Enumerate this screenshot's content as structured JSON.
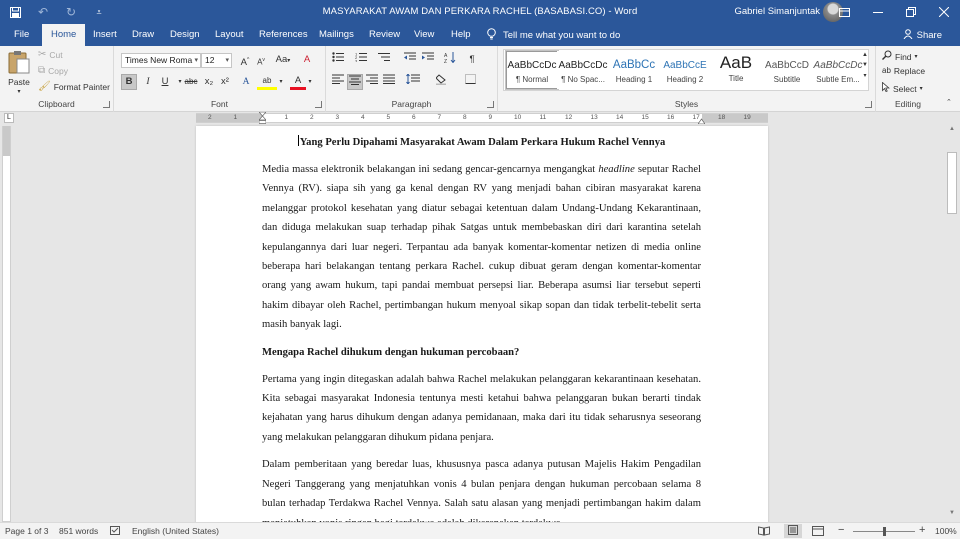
{
  "window": {
    "title": "MASYARAKAT AWAM DAN PERKARA RACHEL (BASABASI.CO)  -  Word",
    "user": "Gabriel Simanjuntak"
  },
  "qat": {
    "save_icon": "save-icon",
    "undo_icon": "undo-icon",
    "redo_icon": "redo-icon",
    "customize_icon": "customize-icon"
  },
  "tabs": [
    "File",
    "Home",
    "Insert",
    "Draw",
    "Design",
    "Layout",
    "References",
    "Mailings",
    "Review",
    "View",
    "Help"
  ],
  "tell_me": "Tell me what you want to do",
  "share": "Share",
  "clipboard": {
    "paste": "Paste",
    "cut": "Cut",
    "copy": "Copy",
    "format_painter": "Format Painter",
    "label": "Clipboard"
  },
  "font": {
    "name": "Times New Roma",
    "size": "12",
    "label": "Font",
    "bold": "B",
    "italic": "I",
    "underline": "U",
    "strike": "abc",
    "subscript": "x₂",
    "superscript": "x²",
    "grow": "A",
    "shrink": "A",
    "case": "Aa",
    "clear": "A",
    "effects": "A",
    "highlight": "ab",
    "color": "A"
  },
  "paragraph": {
    "label": "Paragraph"
  },
  "styles": {
    "label": "Styles",
    "items": [
      {
        "sample": "AaBbCcDc",
        "name": "¶ Normal"
      },
      {
        "sample": "AaBbCcDc",
        "name": "¶ No Spac..."
      },
      {
        "sample": "AaBbCc",
        "name": "Heading 1"
      },
      {
        "sample": "AaBbCcE",
        "name": "Heading 2"
      },
      {
        "sample": "AaB",
        "name": "Title"
      },
      {
        "sample": "AaBbCcD",
        "name": "Subtitle"
      },
      {
        "sample": "AaBbCcDc",
        "name": "Subtle Em..."
      }
    ]
  },
  "editing": {
    "find": "Find",
    "replace": "Replace",
    "select": "Select",
    "label": "Editing"
  },
  "ruler": {
    "marks": [
      "2",
      "1",
      "1",
      "2",
      "3",
      "4",
      "5",
      "6",
      "7",
      "8",
      "9",
      "10",
      "11",
      "12",
      "13",
      "14",
      "15",
      "16",
      "17",
      "18",
      "19"
    ]
  },
  "document": {
    "heading": "Yang Perlu Dipahami Masyarakat Awam Dalam Perkara Hukum Rachel Vennya",
    "p1_before": "Media massa elektronik belakangan ini sedang gencar-gencarnya mengangkat ",
    "p1_italic": "headline",
    "p1_after": " seputar Rachel Vennya (RV). siapa sih yang ga kenal dengan RV yang menjadi bahan cibiran masyarakat karena melanggar protokol kesehatan yang diatur sebagai ketentuan dalam Undang-Undang Kekarantinaan, dan diduga melakukan suap terhadap pihak Satgas untuk membebaskan diri dari karantina setelah kepulangannya dari luar negeri. Terpantau ada banyak komentar-komentar netizen di media online beberapa hari belakangan tentang perkara Rachel. cukup dibuat geram dengan komentar-komentar orang yang awam hukum, tapi pandai membuat persepsi liar. Beberapa asumsi liar tersebut seperti hakim dibayar oleh Rachel, pertimbangan hukum menyoal sikap sopan dan tidak terbelit-tebelit serta masih banyak lagi.",
    "subheading": "Mengapa Rachel dihukum dengan hukuman percobaan?",
    "p2": "Pertama yang ingin ditegaskan adalah bahwa Rachel melakukan pelanggaran kekarantinaan kesehatan. Kita sebagai masyarakat Indonesia tentunya mesti ketahui bahwa pelanggaran bukan berarti tindak kejahatan yang harus dihukum dengan adanya pemidanaan, maka dari itu tidak seharusnya seseorang yang melakukan pelanggaran dihukum pidana penjara.",
    "p3": "Dalam pemberitaan yang beredar luas, khususnya pasca adanya putusan Majelis Hakim Pengadilan Negeri Tanggerang yang menjatuhkan vonis 4 bulan penjara dengan hukuman percobaan selama 8 bulan terhadap Terdakwa Rachel Vennya. Salah satu alasan yang menjadi pertimbangan hakim dalam menjatuhkan vonis ringan bagi terdakwa adalah dikarenakan terdakwa"
  },
  "status": {
    "page": "Page 1 of 3",
    "words": "851 words",
    "language": "English (United States)",
    "zoom": "100%",
    "zoom_percent": 100
  },
  "colors": {
    "accent": "#2b579a",
    "font_color": "#e81123",
    "highlight": "#ffff00"
  }
}
